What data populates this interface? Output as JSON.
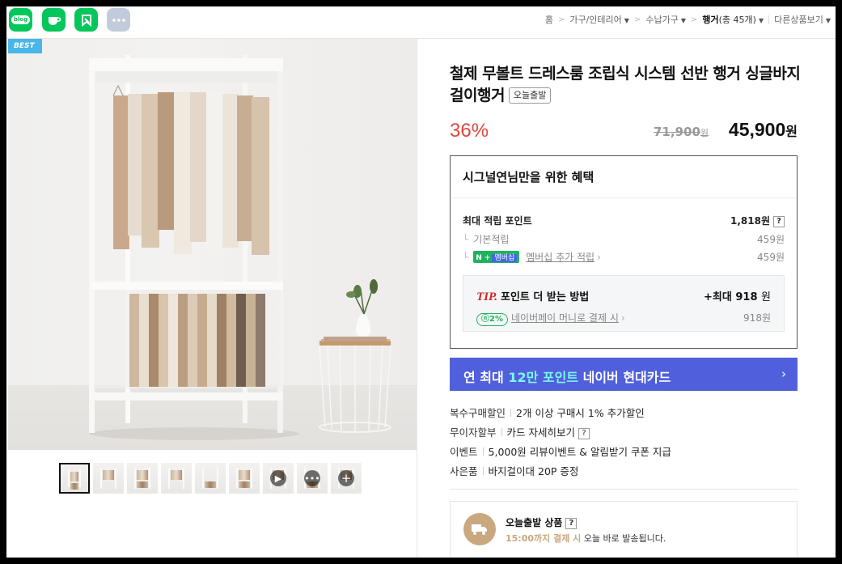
{
  "share": {
    "blog_label": "blog",
    "icons": [
      "naver-blog-icon",
      "naver-cafe-icon",
      "keep-icon",
      "more-icon"
    ]
  },
  "breadcrumb": {
    "home": "홈",
    "cat1": "가구/인테리어",
    "cat2": "수납가구",
    "current": "행거",
    "count": "(총 45개)",
    "other": "다른상품보기"
  },
  "gallery": {
    "badge": "BEST",
    "thumbnail_count": 9
  },
  "product": {
    "title": "철제 무볼트 드레스룸 조립식 시스템 선반 행거 싱글바지걸이행거",
    "tag": "오늘출발",
    "discount": "36%",
    "original_price": "71,900",
    "original_unit": "원",
    "price": "45,900",
    "price_unit": "원"
  },
  "benefit": {
    "title": "시그널연님만을 위한 혜택",
    "max_label": "최대 적립 포인트",
    "max_value": "1,818원",
    "help": "?",
    "basic_label": "기본적립",
    "basic_value": "459원",
    "member_badge_n": "N",
    "member_badge_plus": "+",
    "member_badge_text": "멤버십",
    "member_label": "멤버십 추가 적립",
    "member_value": "459원",
    "tip_tag": "TIP.",
    "tip_label": "포인트 더 받는 방법",
    "tip_max_prefix": "+최대",
    "tip_max_value": "918",
    "tip_max_unit": "원",
    "pay_pct": "2%",
    "pay_label": "네이버페이 머니로 결제 시",
    "pay_value": "918원"
  },
  "card_banner": {
    "pre": "연 최대",
    "highlight": "12만 포인트",
    "post": "네이버 현대카드",
    "arrow": "›"
  },
  "info": {
    "rows": [
      {
        "key": "복수구매할인",
        "value": "2개 이상 구매시 1% 추가할인"
      },
      {
        "key": "무이자할부",
        "value": "카드 자세히보기"
      },
      {
        "key": "이벤트",
        "value": "5,000원 리뷰이벤트 & 알림받기 쿠폰 지급"
      },
      {
        "key": "사은품",
        "value": "바지걸이대 20P 증정"
      }
    ]
  },
  "today": {
    "title": "오늘출발 상품",
    "help": "?",
    "deadline": "15:00까지 결제 시",
    "desc": "오늘 바로 발송됩니다."
  },
  "colors": {
    "naver_green": "#03c75a",
    "discount_red": "#e0473d",
    "banner_blue": "#5060dc",
    "banner_highlight": "#7cf6f0",
    "best_badge": "#48b6e8",
    "today_gold": "#c9a87f"
  }
}
